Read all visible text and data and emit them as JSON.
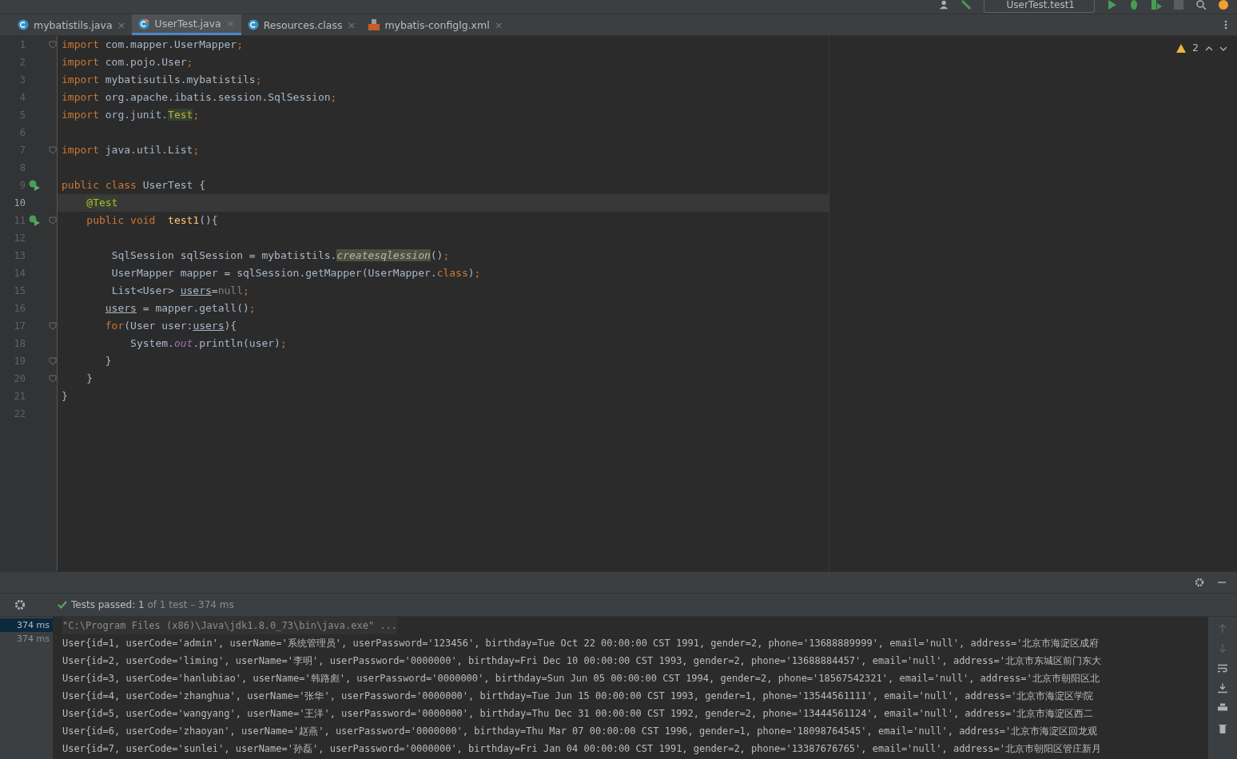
{
  "toolbar": {
    "run_config": "UserTest.test1"
  },
  "tabs": [
    {
      "label": "mybatistils.java",
      "kind": "class",
      "close": "×",
      "selected": false
    },
    {
      "label": "UserTest.java",
      "kind": "test",
      "close": "×",
      "selected": true
    },
    {
      "label": "Resources.class",
      "kind": "class",
      "close": "×",
      "selected": false
    },
    {
      "label": "mybatis-configlg.xml",
      "kind": "xml",
      "close": "×",
      "selected": false
    }
  ],
  "editor": {
    "warnings": "2",
    "lines": [
      {
        "num": "1",
        "run": false,
        "fold": true,
        "current": false,
        "code": [
          {
            "t": "import ",
            "kind": "kw"
          },
          {
            "t": "com.mapper.UserMapper",
            "kind": "id"
          },
          {
            "t": ";",
            "kind": "kw"
          }
        ]
      },
      {
        "num": "2",
        "run": false,
        "fold": false,
        "current": false,
        "code": [
          {
            "t": "import ",
            "kind": "kw"
          },
          {
            "t": "com.pojo.User",
            "kind": "id"
          },
          {
            "t": ";",
            "kind": "kw"
          }
        ]
      },
      {
        "num": "3",
        "run": false,
        "fold": false,
        "current": false,
        "code": [
          {
            "t": "import ",
            "kind": "kw"
          },
          {
            "t": "mybatisutils.mybatistils",
            "kind": "id"
          },
          {
            "t": ";",
            "kind": "kw"
          }
        ]
      },
      {
        "num": "4",
        "run": false,
        "fold": false,
        "current": false,
        "code": [
          {
            "t": "import ",
            "kind": "kw"
          },
          {
            "t": "org.apache.ibatis.session.SqlSession",
            "kind": "id"
          },
          {
            "t": ";",
            "kind": "kw"
          }
        ]
      },
      {
        "num": "5",
        "run": false,
        "fold": false,
        "current": false,
        "code": [
          {
            "t": "import ",
            "kind": "kw"
          },
          {
            "t": "org.junit.",
            "kind": "id"
          },
          {
            "t": "Test",
            "kind": "hl"
          },
          {
            "t": ";",
            "kind": "kw"
          }
        ]
      },
      {
        "num": "6",
        "run": false,
        "fold": false,
        "current": false
      },
      {
        "num": "7",
        "run": false,
        "fold": true,
        "current": false,
        "code": [
          {
            "t": "import ",
            "kind": "kw"
          },
          {
            "t": "java.util.List",
            "kind": "id"
          },
          {
            "t": ";",
            "kind": "kw"
          }
        ]
      },
      {
        "num": "8",
        "run": false,
        "fold": false,
        "current": false
      },
      {
        "num": "9",
        "run": true,
        "fold": false,
        "current": false,
        "code": [
          {
            "t": "public class ",
            "kind": "kw"
          },
          {
            "t": "UserTest {",
            "kind": "id"
          }
        ]
      },
      {
        "num": "10",
        "run": false,
        "fold": false,
        "current": true,
        "code": [
          {
            "t": "    @Test",
            "kind": "ann"
          }
        ]
      },
      {
        "num": "11",
        "run": true,
        "fold": true,
        "current": false,
        "code": [
          {
            "t": "    public void  ",
            "kind": "kw"
          },
          {
            "t": "test1",
            "kind": "fn"
          },
          {
            "t": "(){",
            "kind": "id"
          }
        ]
      },
      {
        "num": "12",
        "run": false,
        "fold": false,
        "current": false
      },
      {
        "num": "13",
        "run": false,
        "fold": false,
        "current": false,
        "code": [
          {
            "t": "        SqlSession sqlSession = mybatistils.",
            "kind": "id"
          },
          {
            "t": "createsqlession",
            "kind": "warn"
          },
          {
            "t": "()",
            "kind": "id"
          },
          {
            "t": ";",
            "kind": "kw"
          }
        ]
      },
      {
        "num": "14",
        "run": false,
        "fold": false,
        "current": false,
        "code": [
          {
            "t": "        UserMapper mapper = sqlSession.getMapper(UserMapper.",
            "kind": "id"
          },
          {
            "t": "class",
            "kind": "kw"
          },
          {
            "t": ")",
            "kind": "id"
          },
          {
            "t": ";",
            "kind": "kw"
          }
        ]
      },
      {
        "num": "15",
        "run": false,
        "fold": false,
        "current": false,
        "code": [
          {
            "t": "        List<User> ",
            "kind": "id"
          },
          {
            "t": "users",
            "kind": "ul"
          },
          {
            "t": "=",
            "kind": "id"
          },
          {
            "t": "null",
            "kind": "null"
          },
          {
            "t": ";",
            "kind": "kw"
          }
        ]
      },
      {
        "num": "16",
        "run": false,
        "fold": false,
        "current": false,
        "code": [
          {
            "t": "       users",
            "kind": "ul"
          },
          {
            "t": " = mapper.getall()",
            "kind": "id"
          },
          {
            "t": ";",
            "kind": "kw"
          }
        ]
      },
      {
        "num": "17",
        "run": false,
        "fold": true,
        "current": false,
        "code": [
          {
            "t": "       for",
            "kind": "kw"
          },
          {
            "t": "(User user:",
            "kind": "id"
          },
          {
            "t": "users",
            "kind": "ul"
          },
          {
            "t": "){",
            "kind": "id"
          }
        ]
      },
      {
        "num": "18",
        "run": false,
        "fold": false,
        "current": false,
        "code": [
          {
            "t": "           System.",
            "kind": "id"
          },
          {
            "t": "out",
            "kind": "it"
          },
          {
            "t": ".println(user)",
            "kind": "id"
          },
          {
            "t": ";",
            "kind": "kw"
          }
        ]
      },
      {
        "num": "19",
        "run": false,
        "fold": true,
        "current": false,
        "code": [
          {
            "t": "       }",
            "kind": "id"
          }
        ]
      },
      {
        "num": "20",
        "run": false,
        "fold": true,
        "current": false,
        "code": [
          {
            "t": "    }",
            "kind": "id"
          }
        ]
      },
      {
        "num": "21",
        "run": false,
        "fold": false,
        "current": false,
        "code": [
          {
            "t": "}",
            "kind": "id"
          }
        ]
      },
      {
        "num": "22",
        "run": false,
        "fold": false,
        "current": false
      }
    ]
  },
  "test_status": {
    "label": "Tests passed:",
    "count": "1",
    "detail": "of 1 test – 374 ms"
  },
  "test_tree": [
    {
      "time": "374 ms",
      "selected": true
    },
    {
      "time": "374 ms",
      "selected": false
    }
  ],
  "console": {
    "command": "\"C:\\Program Files (x86)\\Java\\jdk1.8.0_73\\bin\\java.exe\" ...",
    "lines": [
      "User{id=1, userCode='admin', userName='系统管理员', userPassword='123456', birthday=Tue Oct 22 00:00:00 CST 1991, gender=2, phone='13688889999', email='null', address='北京市海淀区成府",
      "User{id=2, userCode='liming', userName='李明', userPassword='0000000', birthday=Fri Dec 10 00:00:00 CST 1993, gender=2, phone='13688884457', email='null', address='北京市东城区前门东大",
      "User{id=3, userCode='hanlubiao', userName='韩路彪', userPassword='0000000', birthday=Sun Jun 05 00:00:00 CST 1994, gender=2, phone='18567542321', email='null', address='北京市朝阳区北",
      "User{id=4, userCode='zhanghua', userName='张华', userPassword='0000000', birthday=Tue Jun 15 00:00:00 CST 1993, gender=1, phone='13544561111', email='null', address='北京市海淀区学院",
      "User{id=5, userCode='wangyang', userName='王洋', userPassword='0000000', birthday=Thu Dec 31 00:00:00 CST 1992, gender=2, phone='13444561124', email='null', address='北京市海淀区西二",
      "User{id=6, userCode='zhaoyan', userName='赵燕', userPassword='0000000', birthday=Thu Mar 07 00:00:00 CST 1996, gender=1, phone='18098764545', email='null', address='北京市海淀区回龙观",
      "User{id=7, userCode='sunlei', userName='孙磊', userPassword='0000000', birthday=Fri Jan 04 00:00:00 CST 1991, gender=2, phone='13387676765', email='null', address='北京市朝阳区管庄新月"
    ]
  }
}
